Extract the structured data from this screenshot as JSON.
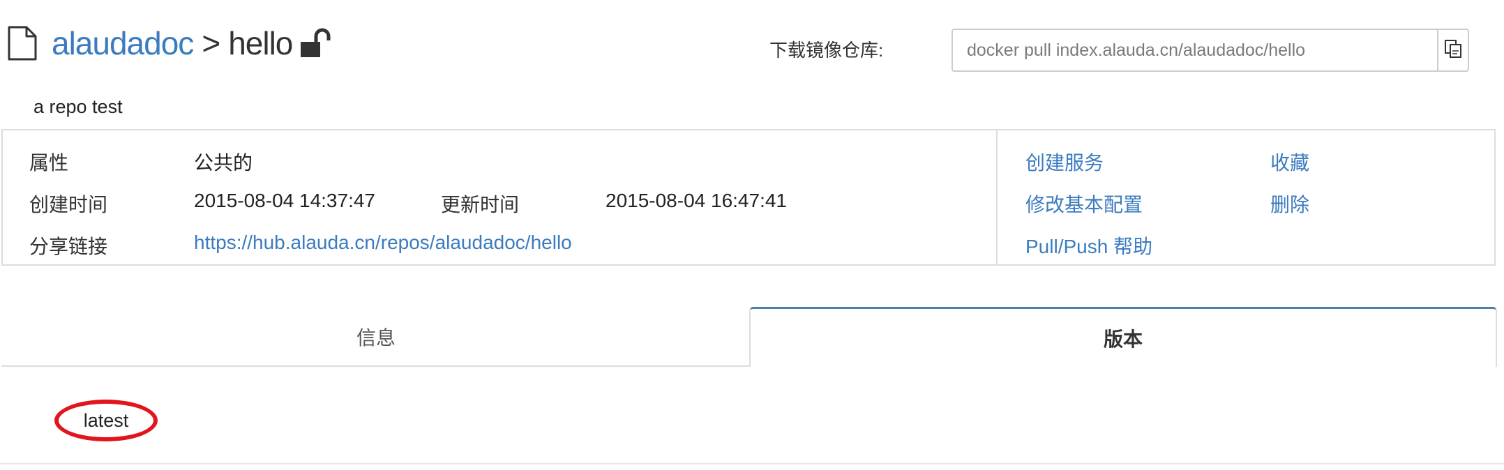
{
  "header": {
    "owner": "alaudadoc",
    "separator": ">",
    "repo_name": "hello",
    "description": "a repo test"
  },
  "pull": {
    "label": "下载镜像仓库:",
    "command": "docker pull index.alauda.cn/alaudadoc/hello"
  },
  "info": {
    "property_label": "属性",
    "property_value": "公共的",
    "created_label": "创建时间",
    "created_value": "2015-08-04 14:37:47",
    "updated_label": "更新时间",
    "updated_value": "2015-08-04 16:47:41",
    "share_label": "分享链接",
    "share_url": "https://hub.alauda.cn/repos/alaudadoc/hello"
  },
  "actions": {
    "create_service": "创建服务",
    "favorite": "收藏",
    "edit_config": "修改基本配置",
    "delete": "删除",
    "pull_push_help": "Pull/Push 帮助"
  },
  "tabs": [
    {
      "label": "信息",
      "active": false
    },
    {
      "label": "版本",
      "active": true
    }
  ],
  "versions": [
    {
      "tag": "latest"
    }
  ],
  "colors": {
    "link": "#3b7bbf",
    "active_tab_border": "#4f80a8",
    "highlight_circle": "#e2141e"
  }
}
